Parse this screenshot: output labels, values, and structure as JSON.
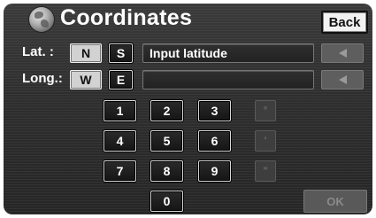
{
  "header": {
    "title": "Coordinates",
    "back_label": "Back",
    "icon": "globe-icon"
  },
  "latitude": {
    "label": "Lat. :",
    "options": [
      "N",
      "S"
    ],
    "selected": "N",
    "field_value": "Input latitude"
  },
  "longitude": {
    "label": "Long.:",
    "options": [
      "W",
      "E"
    ],
    "selected": "W",
    "field_value": ""
  },
  "keypad": {
    "digits": [
      "1",
      "2",
      "3",
      "4",
      "5",
      "6",
      "7",
      "8",
      "9",
      "0"
    ],
    "units": [
      "°",
      "'",
      "\""
    ]
  },
  "ok_label": "OK",
  "colors": {
    "background": "#2e2e2e",
    "selected_key": "#d2d2d2",
    "disabled": "#5e5e5e",
    "text": "#ffffff"
  }
}
